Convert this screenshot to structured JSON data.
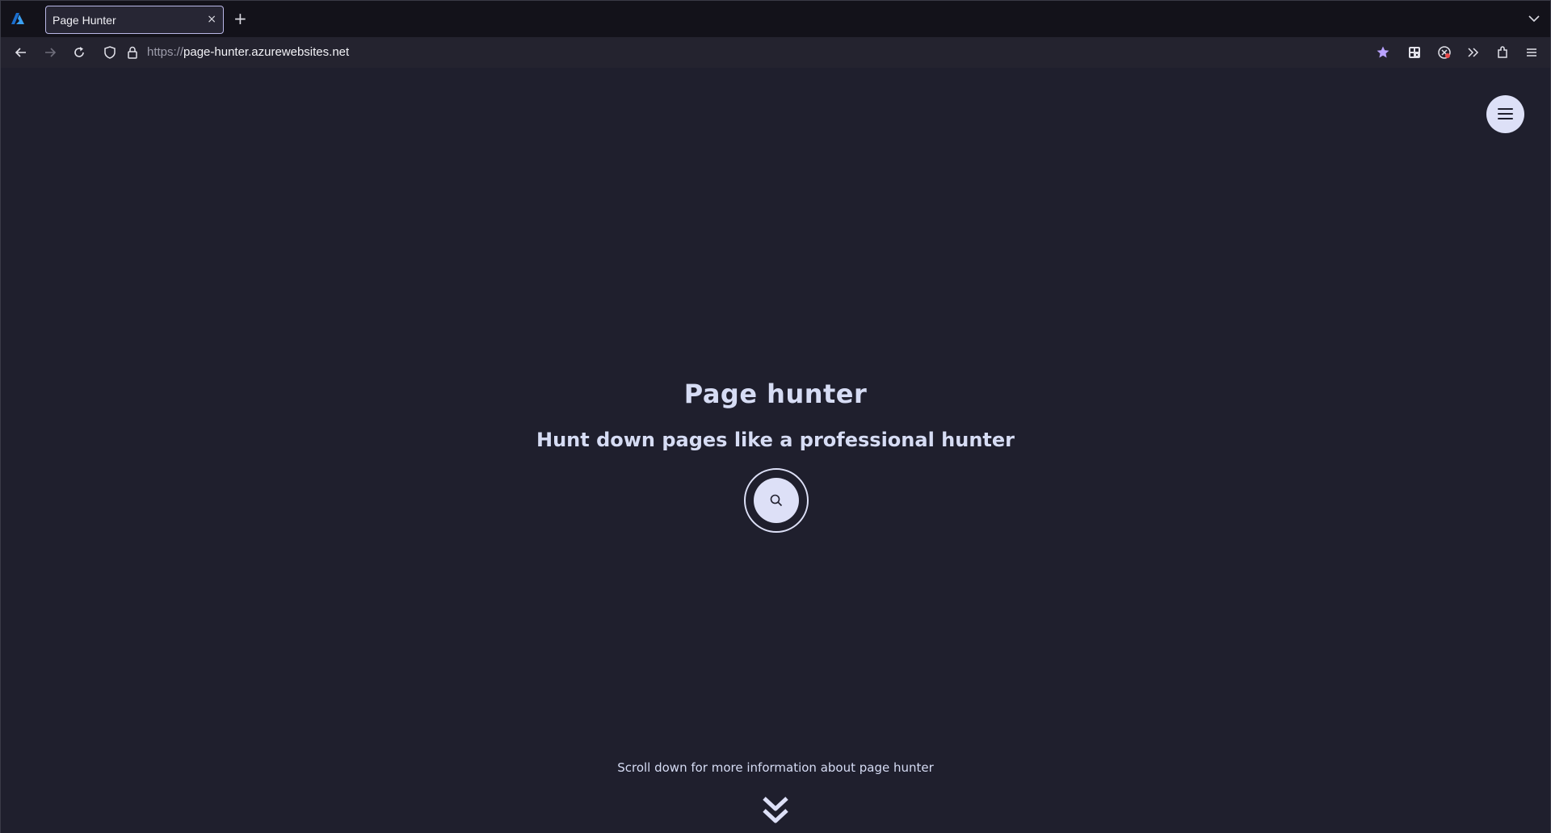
{
  "browser": {
    "tab": {
      "title": "Page Hunter",
      "close_glyph": "×",
      "favicon": "azure-logo-icon"
    },
    "new_tab_glyph": "+",
    "url": {
      "scheme": "https://",
      "host": "page-hunter.azurewebsites.net"
    },
    "toolbar_icons": [
      "star-icon",
      "qr-code-icon",
      "profile-icon",
      "overflow-icon",
      "extensions-icon",
      "menu-icon"
    ],
    "accent_color": "#b9a2ff"
  },
  "page": {
    "title": "Page hunter",
    "subtitle": "Hunt down pages like a professional hunter",
    "scroll_hint": "Scroll down for more information about page hunter",
    "background_color": "#1f1f2d",
    "accent_color": "#dde0f7"
  }
}
